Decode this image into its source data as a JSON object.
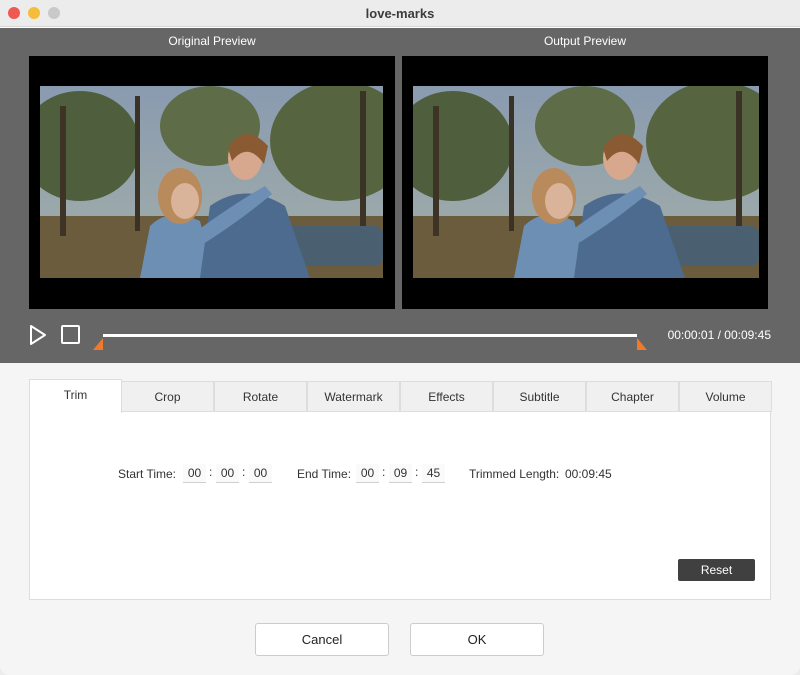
{
  "window": {
    "title": "love-marks"
  },
  "preview": {
    "original_label": "Original Preview",
    "output_label": "Output Preview",
    "progress_start": 0.0,
    "progress_end": 1.0
  },
  "playback": {
    "current_time": "00:00:01",
    "total_time": "00:09:45",
    "time_display": "00:00:01 / 00:09:45",
    "play_icon": "play-icon",
    "stop_icon": "stop-icon"
  },
  "tabs": [
    {
      "label": "Trim",
      "active": true
    },
    {
      "label": "Crop",
      "active": false
    },
    {
      "label": "Rotate",
      "active": false
    },
    {
      "label": "Watermark",
      "active": false
    },
    {
      "label": "Effects",
      "active": false
    },
    {
      "label": "Subtitle",
      "active": false
    },
    {
      "label": "Chapter",
      "active": false
    },
    {
      "label": "Volume",
      "active": false
    }
  ],
  "trim": {
    "start_label": "Start Time:",
    "start": {
      "hh": "00",
      "mm": "00",
      "ss": "00"
    },
    "end_label": "End Time:",
    "end": {
      "hh": "00",
      "mm": "09",
      "ss": "45"
    },
    "length_label": "Trimmed Length:",
    "length_value": "00:09:45",
    "reset_label": "Reset"
  },
  "footer": {
    "cancel_label": "Cancel",
    "ok_label": "OK"
  },
  "colors": {
    "accent": "#f07a2c",
    "preview_bg": "#666666",
    "reset_bg": "#404040"
  }
}
